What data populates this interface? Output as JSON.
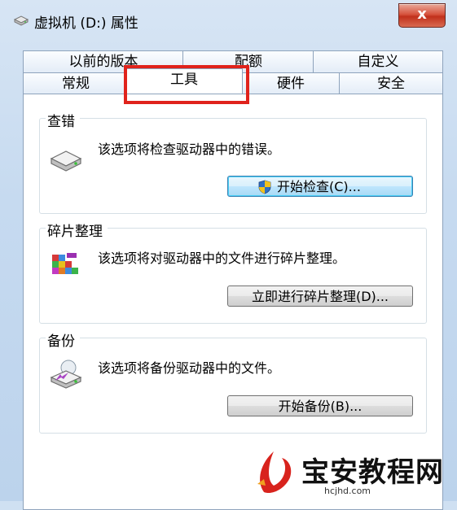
{
  "window": {
    "title": "虚拟机 (D:) 属性",
    "close_label": "x"
  },
  "tabs_row1": [
    "以前的版本",
    "配额",
    "自定义"
  ],
  "tabs_row2": [
    "常规",
    "工具",
    "硬件",
    "安全"
  ],
  "active_tab": "工具",
  "groups": [
    {
      "title": "查错",
      "description": "该选项将检查驱动器中的错误。",
      "button_label": "开始检查(C)...",
      "icon": "drive-icon"
    },
    {
      "title": "碎片整理",
      "description": "该选项将对驱动器中的文件进行碎片整理。",
      "button_label": "立即进行碎片整理(D)...",
      "icon": "defrag-icon"
    },
    {
      "title": "备份",
      "description": "该选项将备份驱动器中的文件。",
      "button_label": "开始备份(B)...",
      "icon": "backup-icon"
    }
  ],
  "watermark": {
    "text": "宝安教程网",
    "url": "hcjhd.com"
  },
  "colors": {
    "highlight": "#e0231c",
    "shield_blue": "#2f6fc4",
    "shield_yellow": "#f2c21b"
  }
}
